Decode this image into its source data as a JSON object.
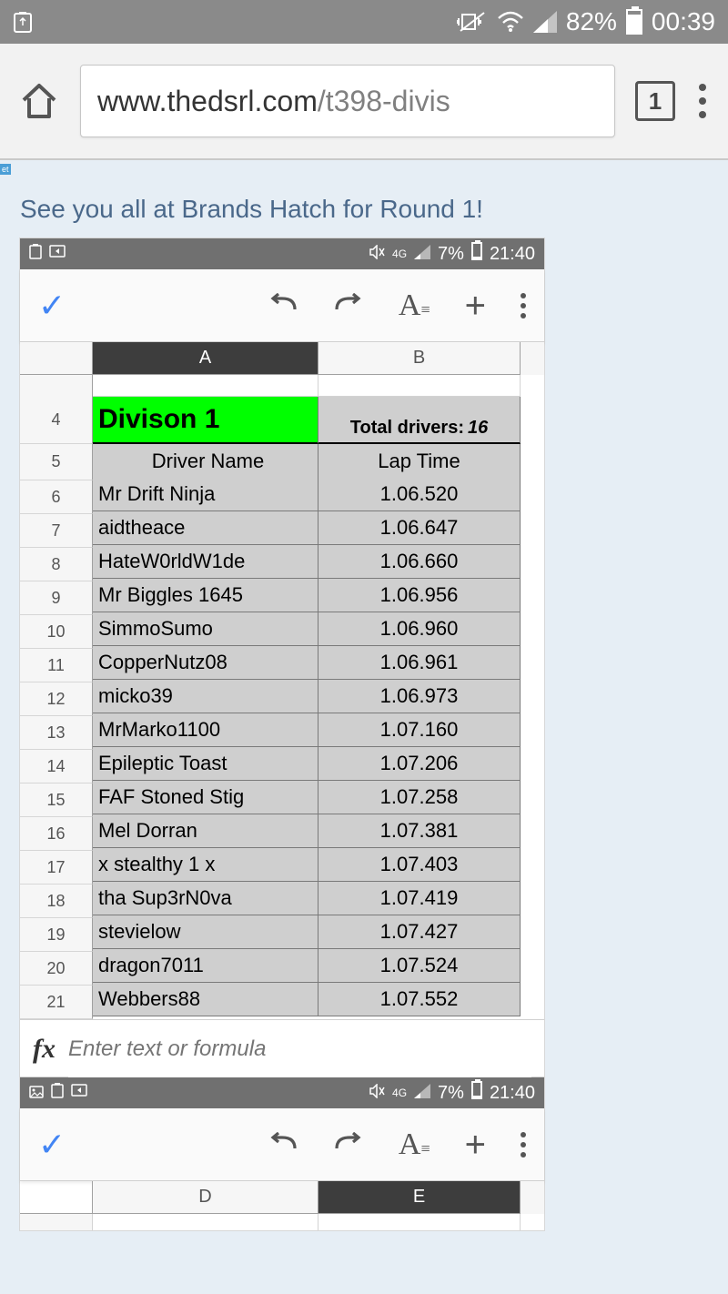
{
  "outer_status": {
    "battery_pct": "82%",
    "time": "00:39"
  },
  "browser": {
    "url_host": "www.thedsrl.com",
    "url_path": "/t398-divis",
    "tab_count": "1"
  },
  "page": {
    "micro_tag": "et",
    "intro_text": "See you all at Brands Hatch for Round 1!"
  },
  "inner_status": {
    "network_label": "4G",
    "battery_pct": "7%",
    "time": "21:40"
  },
  "sheet": {
    "col_headers": [
      "A",
      "B"
    ],
    "title_cell": "Divison 1",
    "total_drivers_label": "Total drivers:",
    "total_drivers_value": "16",
    "subheaders": [
      "Driver Name",
      "Lap Time"
    ],
    "row_start": 4,
    "rows": [
      {
        "n": 6,
        "name": "Mr Drift Ninja",
        "time": "1.06.520"
      },
      {
        "n": 7,
        "name": "aidtheace",
        "time": "1.06.647"
      },
      {
        "n": 8,
        "name": "HateW0rldW1de",
        "time": "1.06.660"
      },
      {
        "n": 9,
        "name": "Mr Biggles 1645",
        "time": "1.06.956"
      },
      {
        "n": 10,
        "name": "SimmoSumo",
        "time": "1.06.960"
      },
      {
        "n": 11,
        "name": "CopperNutz08",
        "time": "1.06.961"
      },
      {
        "n": 12,
        "name": "micko39",
        "time": "1.06.973"
      },
      {
        "n": 13,
        "name": "MrMarko1100",
        "time": "1.07.160"
      },
      {
        "n": 14,
        "name": "Epileptic Toast",
        "time": "1.07.206"
      },
      {
        "n": 15,
        "name": "FAF Stoned Stig",
        "time": "1.07.258"
      },
      {
        "n": 16,
        "name": "Mel Dorran",
        "time": "1.07.381"
      },
      {
        "n": 17,
        "name": "x stealthy 1 x",
        "time": "1.07.403"
      },
      {
        "n": 18,
        "name": "tha Sup3rN0va",
        "time": "1.07.419"
      },
      {
        "n": 19,
        "name": "stevielow",
        "time": "1.07.427"
      },
      {
        "n": 20,
        "name": "dragon7011",
        "time": "1.07.524"
      },
      {
        "n": 21,
        "name": "Webbers88",
        "time": "1.07.552"
      }
    ]
  },
  "formula_bar": {
    "fx_label": "fx",
    "placeholder": "Enter text or formula"
  },
  "inner_status2": {
    "network_label": "4G",
    "battery_pct": "7%",
    "time": "21:40"
  },
  "sheet2": {
    "col_headers": [
      "D",
      "E"
    ]
  },
  "chart_data": {
    "type": "table",
    "title": "Divison 1",
    "columns": [
      "Driver Name",
      "Lap Time"
    ],
    "total_drivers": 16,
    "rows": [
      [
        "Mr Drift Ninja",
        "1.06.520"
      ],
      [
        "aidtheace",
        "1.06.647"
      ],
      [
        "HateW0rldW1de",
        "1.06.660"
      ],
      [
        "Mr Biggles 1645",
        "1.06.956"
      ],
      [
        "SimmoSumo",
        "1.06.960"
      ],
      [
        "CopperNutz08",
        "1.06.961"
      ],
      [
        "micko39",
        "1.06.973"
      ],
      [
        "MrMarko1100",
        "1.07.160"
      ],
      [
        "Epileptic Toast",
        "1.07.206"
      ],
      [
        "FAF Stoned Stig",
        "1.07.258"
      ],
      [
        "Mel Dorran",
        "1.07.381"
      ],
      [
        "x stealthy 1 x",
        "1.07.403"
      ],
      [
        "tha Sup3rN0va",
        "1.07.419"
      ],
      [
        "stevielow",
        "1.07.427"
      ],
      [
        "dragon7011",
        "1.07.524"
      ],
      [
        "Webbers88",
        "1.07.552"
      ]
    ]
  }
}
